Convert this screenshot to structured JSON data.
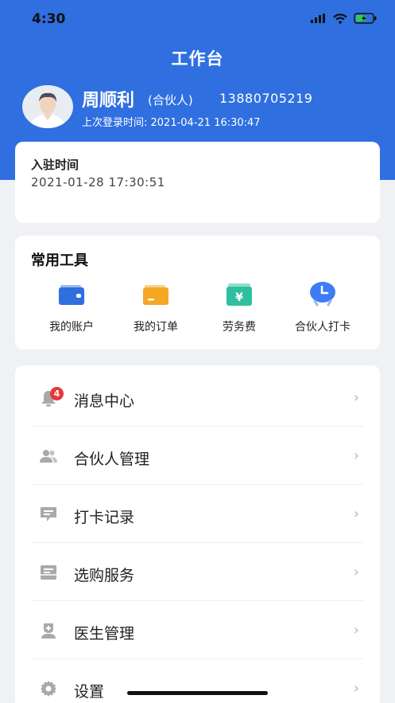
{
  "status_bar": {
    "time": "4:30"
  },
  "header": {
    "title": "工作台",
    "user": {
      "name": "周顺利",
      "role": "(合伙人)",
      "phone": "13880705219",
      "last_login": "上次登录时间: 2021-04-21 16:30:47"
    },
    "color": "#2f6fe0"
  },
  "join_card": {
    "label": "入驻时间",
    "value": "2021-01-28 17:30:51"
  },
  "tools": {
    "title": "常用工具",
    "items": [
      {
        "label": "我的账户",
        "icon": "wallet-icon",
        "color": "#2f6fe0"
      },
      {
        "label": "我的订单",
        "icon": "order-folder-icon",
        "color": "#f5a623"
      },
      {
        "label": "劳务费",
        "icon": "yuan-bill-icon",
        "color": "#2fbf9f"
      },
      {
        "label": "合伙人打卡",
        "icon": "clock-icon",
        "color": "#3d7cf5"
      }
    ]
  },
  "menu": {
    "items": [
      {
        "label": "消息中心",
        "icon": "bell-icon",
        "badge": "4"
      },
      {
        "label": "合伙人管理",
        "icon": "users-icon"
      },
      {
        "label": "打卡记录",
        "icon": "checkin-record-icon"
      },
      {
        "label": "选购服务",
        "icon": "purchase-service-icon"
      },
      {
        "label": "医生管理",
        "icon": "doctor-icon"
      },
      {
        "label": "设置",
        "icon": "settings-gear-icon"
      }
    ],
    "chevron": "›"
  }
}
